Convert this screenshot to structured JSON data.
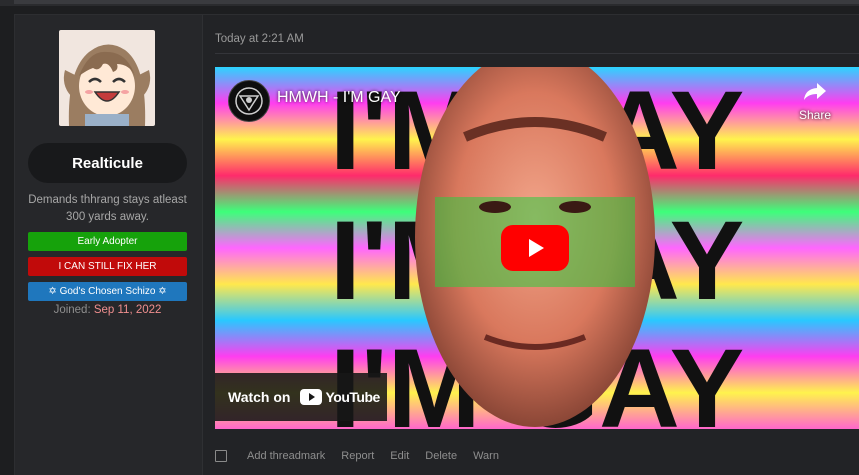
{
  "user": {
    "username": "Realticule",
    "title": "Demands thhrang stays atleast 300 yards away.",
    "banners": [
      {
        "label": "Early Adopter",
        "color": "#16a20b"
      },
      {
        "label": "I CAN STILL FIX HER",
        "color": "#c10a0a"
      },
      {
        "label": "✡ God's Chosen Schizo ✡",
        "color": "#1f77bd"
      }
    ],
    "joined_label": "Joined:",
    "joined_date": "Sep 11, 2022"
  },
  "post": {
    "timestamp": "Today at 2:21 AM"
  },
  "video": {
    "title": "HMWH - I'M GAY",
    "share_label": "Share",
    "watch_on": "Watch on",
    "youtube_label": "YouTube",
    "background_text": [
      "I'M GAY",
      "I'M GAY",
      "I'M GAY"
    ],
    "play_color": "#ff0000"
  },
  "actions": {
    "threadmark": "Add threadmark",
    "report": "Report",
    "edit": "Edit",
    "delete": "Delete",
    "warn": "Warn"
  },
  "icons": {
    "avatar": "anime-girl-avatar",
    "channel": "channel-logo-icon",
    "share": "share-arrow-icon",
    "play": "play-icon",
    "youtube": "youtube-logo-icon"
  }
}
